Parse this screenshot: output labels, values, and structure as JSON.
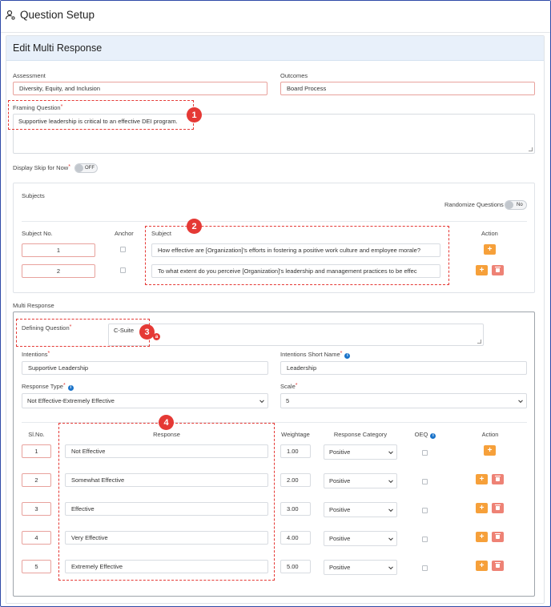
{
  "app": {
    "title": "Question Setup",
    "icon": "user-settings-icon"
  },
  "panel": {
    "title": "Edit Multi Response"
  },
  "assessment": {
    "label": "Assessment",
    "value": "Diversity, Equity, and Inclusion"
  },
  "outcomes": {
    "label": "Outcomes",
    "value": "Board Process"
  },
  "framing": {
    "label": "Framing Question",
    "value": "Supportive leadership is critical to an effective DEI program."
  },
  "skip": {
    "label": "Display Skip for Now",
    "toggle": "OFF"
  },
  "subjects": {
    "title": "Subjects",
    "randomize_label": "Randomize Questions",
    "randomize_toggle": "No",
    "headers": {
      "no": "Subject No.",
      "anchor": "Anchor",
      "subject": "Subject",
      "action": "Action"
    },
    "rows": [
      {
        "no": "1",
        "text": "How effective are [Organization]'s efforts in fostering a positive work culture and employee morale?"
      },
      {
        "no": "2",
        "text": "To what extent do you perceive [Organization]'s leadership and management practices to be effec"
      }
    ]
  },
  "multi": {
    "title": "Multi Response",
    "defining_label": "Defining Question",
    "defining_value": "C-Suite",
    "intentions_label": "Intentions",
    "intentions_value": "Supportive Leadership",
    "short_label": "Intentions Short Name",
    "short_value": "Leadership",
    "type_label": "Response Type",
    "type_value": "Not Effective-Extremely Effective",
    "scale_label": "Scale",
    "scale_value": "5",
    "headers": {
      "sl": "Sl.No.",
      "response": "Response",
      "weightage": "Weightage",
      "category": "Response Category",
      "oeq": "OEQ",
      "action": "Action"
    },
    "rows": [
      {
        "sl": "1",
        "response": "Not Effective",
        "weightage": "1.00",
        "category": "Positive"
      },
      {
        "sl": "2",
        "response": "Somewhat Effective",
        "weightage": "2.00",
        "category": "Positive"
      },
      {
        "sl": "3",
        "response": "Effective",
        "weightage": "3.00",
        "category": "Positive"
      },
      {
        "sl": "4",
        "response": "Very Effective",
        "weightage": "4.00",
        "category": "Positive"
      },
      {
        "sl": "5",
        "response": "Extremely Effective",
        "weightage": "5.00",
        "category": "Positive"
      }
    ]
  },
  "callouts": {
    "c1": "1",
    "c2": "2",
    "c3": "3",
    "c3_sub": "a",
    "c4": "4"
  },
  "colors": {
    "accent_red": "#e53935",
    "add_orange": "#f6a03a",
    "delete_salmon": "#ee8275",
    "header_bg": "#e8f0fa"
  }
}
